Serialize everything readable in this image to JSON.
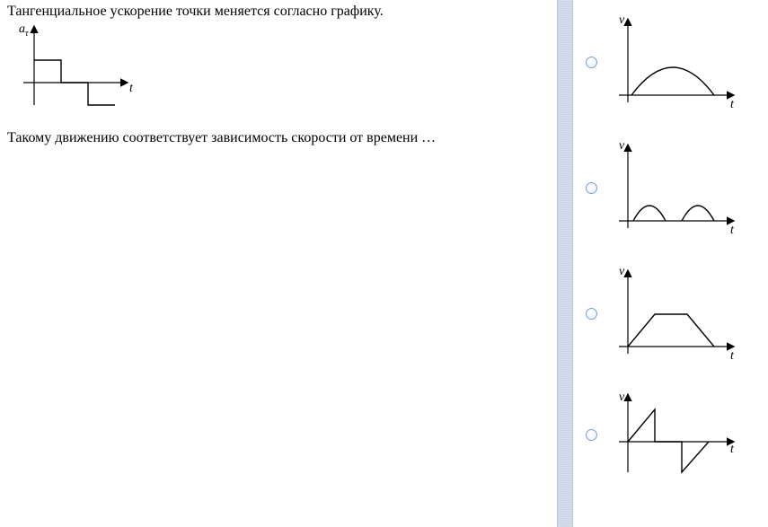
{
  "question": {
    "line1": "Тангенциальное ускорение точки меняется согласно графику.",
    "line2": "Такому движению соответствует зависимость скорости от времени …",
    "graph": {
      "y_label": "a",
      "y_sub": "τ",
      "x_label": "t"
    }
  },
  "options": [
    {
      "id": "opt1",
      "shape": "half-arc",
      "y_label": "v",
      "x_label": "t"
    },
    {
      "id": "opt2",
      "shape": "two-humps",
      "y_label": "v",
      "x_label": "t"
    },
    {
      "id": "opt3",
      "shape": "trapezoid",
      "y_label": "v",
      "x_label": "t"
    },
    {
      "id": "opt4",
      "shape": "sawtooth",
      "y_label": "v",
      "x_label": "t"
    }
  ],
  "chart_data": {
    "question_graph": {
      "type": "line",
      "title": "Tangential acceleration vs time (step function)",
      "xlabel": "t",
      "ylabel": "a_tau",
      "segments": [
        {
          "t_range": [
            0,
            1
          ],
          "a": 1
        },
        {
          "t_range": [
            1,
            2
          ],
          "a": 0
        },
        {
          "t_range": [
            2,
            3
          ],
          "a": -1
        }
      ]
    },
    "option_graphs": [
      {
        "id": "opt1",
        "type": "line",
        "xlabel": "t",
        "ylabel": "v",
        "description": "single half-sine/arc hump from 0 back to 0"
      },
      {
        "id": "opt2",
        "type": "line",
        "xlabel": "t",
        "ylabel": "v",
        "description": "two separated half-sine humps"
      },
      {
        "id": "opt3",
        "type": "line",
        "xlabel": "t",
        "ylabel": "v",
        "description": "trapezoid: rise, plateau, fall"
      },
      {
        "id": "opt4",
        "type": "line",
        "xlabel": "t",
        "ylabel": "v",
        "description": "sawtooth crossing zero: rise, vertical drop below axis, rise back"
      }
    ]
  }
}
